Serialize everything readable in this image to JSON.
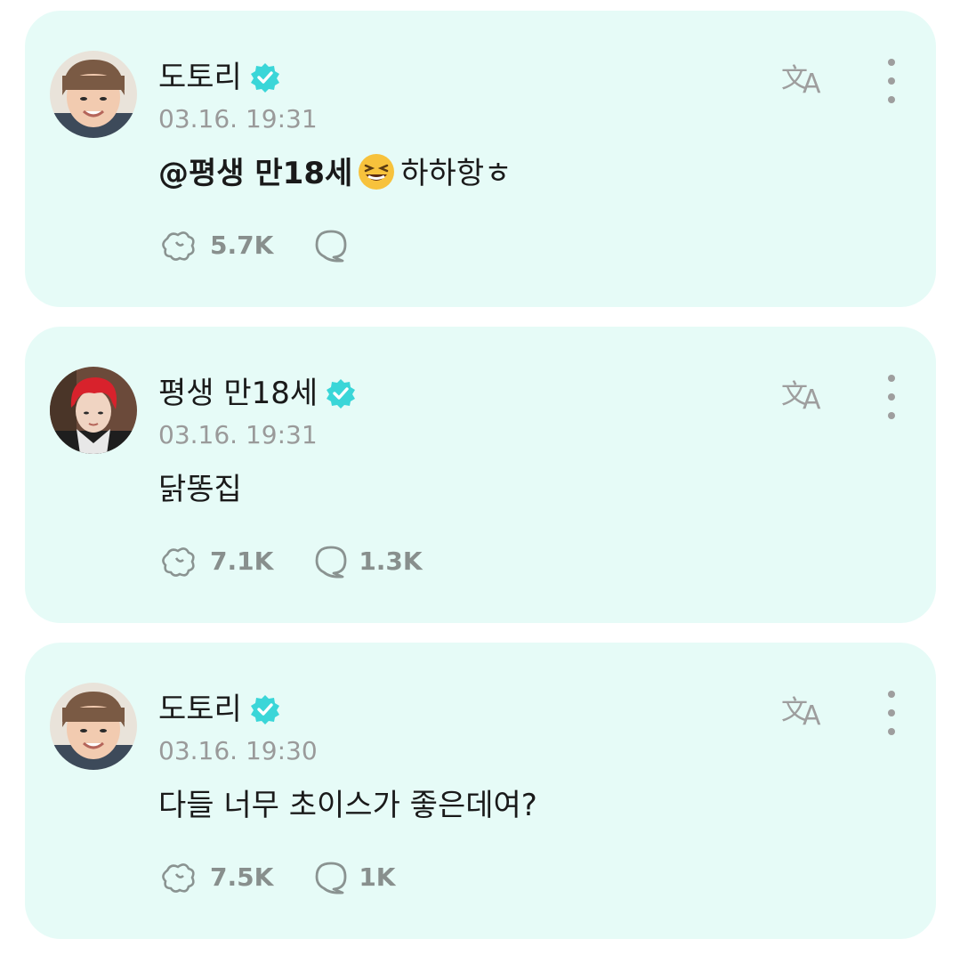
{
  "comments": [
    {
      "author": "도토리",
      "time": "03.16. 19:31",
      "mention": "@평생 만18세",
      "emoji_icon": "grinning-squinting-face-emoji",
      "text": "하하항ㅎ",
      "likes": "5.7K",
      "replies": ""
    },
    {
      "author": "평생 만18세",
      "time": "03.16. 19:31",
      "mention": "",
      "text": "닭똥집",
      "likes": "7.1K",
      "replies": "1.3K"
    },
    {
      "author": "도토리",
      "time": "03.16. 19:30",
      "mention": "",
      "text": "다들 너무 초이스가 좋은데여?",
      "likes": "7.5K",
      "replies": "1K"
    }
  ],
  "colors": {
    "card_bg": "#e6fbf7",
    "verified": "#3ad6d8",
    "meta_gray": "#9a9a9a"
  },
  "icons": [
    "verified-badge-icon",
    "translate-icon",
    "more-vertical-icon",
    "like-icon",
    "reply-bubble-icon"
  ]
}
